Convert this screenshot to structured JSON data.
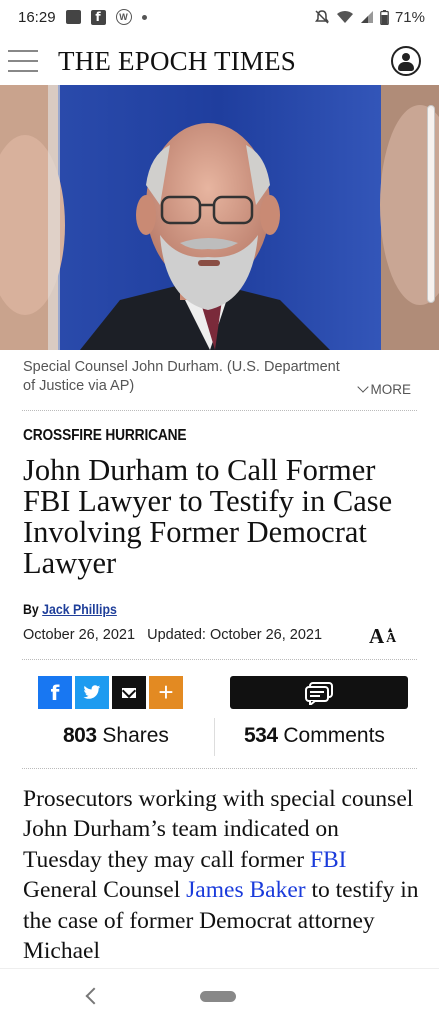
{
  "status_bar": {
    "time": "16:29",
    "battery": "71%"
  },
  "header": {
    "masthead": "THE EPOCH TIMES"
  },
  "hero": {
    "caption": "Special Counsel John Durham. (U.S. Department of Justice via AP)",
    "more_label": "MORE"
  },
  "article": {
    "kicker": "CROSSFIRE HURRICANE",
    "headline": "John Durham to Call Former FBI Lawyer to Testify in Case Involving Former Democrat Lawyer",
    "by_label": "By",
    "author": "Jack Phillips",
    "date": "October 26, 2021",
    "updated": "Updated: October 26, 2021",
    "font_big": "A",
    "font_small": "A"
  },
  "share": {
    "facebook": "f",
    "twitter": "🐦",
    "plus": "+",
    "shares_count": "803",
    "shares_label": "Shares",
    "comments_count": "534",
    "comments_label": "Comments"
  },
  "body": {
    "p1_a": "Prosecutors working with special counsel John Durham’s team indicated on Tuesday they may call former ",
    "link_fbi": "FBI",
    "p1_b": " General Counsel ",
    "link_james": "James Baker",
    "p1_c": " to testify in the case of former Democrat attorney Michael"
  },
  "colors": {
    "facebook": "#1877f2",
    "twitter": "#1d9bf0",
    "email": "#111111",
    "plus": "#e38a22",
    "link": "#1a3bdb",
    "author_link": "#1f3f9a"
  }
}
